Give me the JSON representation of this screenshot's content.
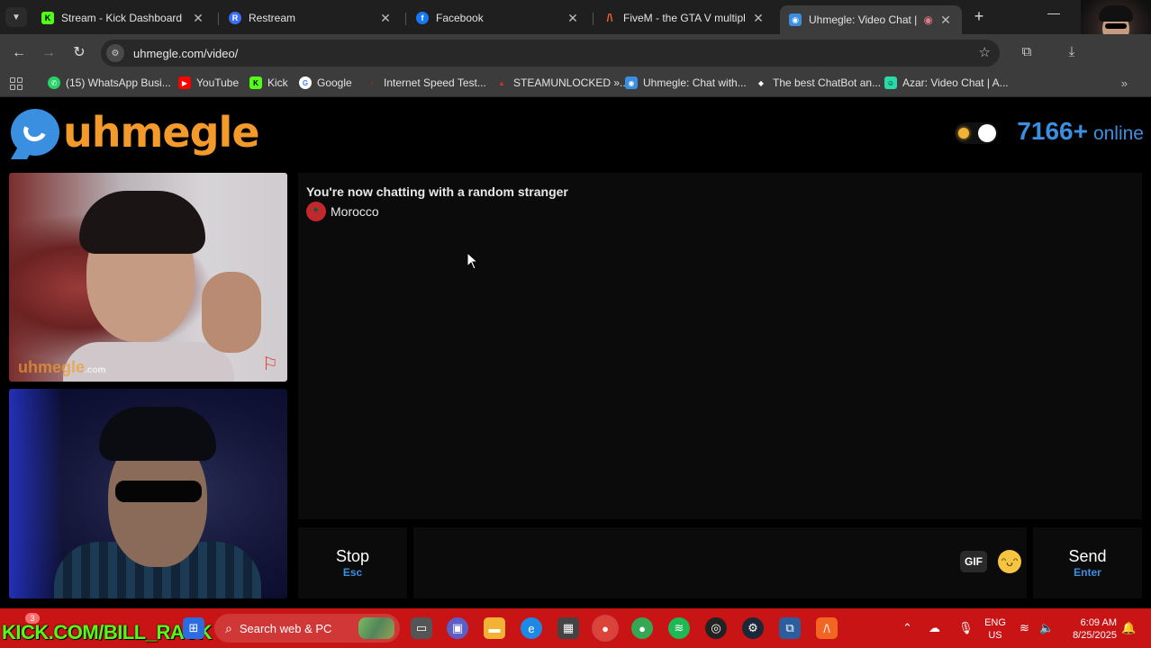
{
  "browser": {
    "tabs": [
      {
        "title": "Stream - Kick Dashboard",
        "favicon": "K",
        "favicon_color": "#53fc18"
      },
      {
        "title": "Restream",
        "favicon": "R",
        "favicon_color": "#3b6ef5"
      },
      {
        "title": "Facebook",
        "favicon": "f",
        "favicon_color": "#1877f2"
      },
      {
        "title": "FiveM - the GTA V multiplay",
        "favicon": "/\\",
        "favicon_color": "#f26522"
      },
      {
        "title": "Uhmegle: Video Chat | C",
        "favicon": "◉",
        "favicon_color": "#3a8fe0"
      }
    ],
    "url": "uhmegle.com/video/",
    "bookmarks": [
      {
        "label": "(15) WhatsApp Busi...",
        "color": "#25d366"
      },
      {
        "label": "YouTube",
        "color": "#ff0000"
      },
      {
        "label": "Kick",
        "color": "#53fc18"
      },
      {
        "label": "Google",
        "color": "#ffffff"
      },
      {
        "label": "Internet Speed Test...",
        "color": "#b71c1c"
      },
      {
        "label": "STEAMUNLOCKED »...",
        "color": "#d32f2f"
      },
      {
        "label": "Uhmegle: Chat with...",
        "color": "#3a8fe0"
      },
      {
        "label": "The best ChatBot an...",
        "color": "#ffffff"
      },
      {
        "label": "Azar: Video Chat | A...",
        "color": "#2bd9a8"
      }
    ]
  },
  "site": {
    "logo_text": "uhmegle",
    "online_count": "7166+",
    "online_label": "online",
    "watermark": "uhmegle",
    "watermark_suffix": ".com"
  },
  "chat": {
    "status": "You're now chatting with a random stranger",
    "country": "Morocco"
  },
  "controls": {
    "stop_label": "Stop",
    "stop_key": "Esc",
    "gif_label": "GIF",
    "send_label": "Send",
    "send_key": "Enter"
  },
  "taskbar": {
    "overlay_text": "KICK.COM/BILL_RACK",
    "badge": "3",
    "search_text": "Search web & PC",
    "lang_top": "ENG",
    "lang_bottom": "US",
    "time": "6:09 AM",
    "date": "8/25/2025"
  },
  "colors": {
    "brand_blue": "#3a8fe0",
    "brand_orange": "#f39a2b",
    "taskbar_red": "#c81414"
  }
}
